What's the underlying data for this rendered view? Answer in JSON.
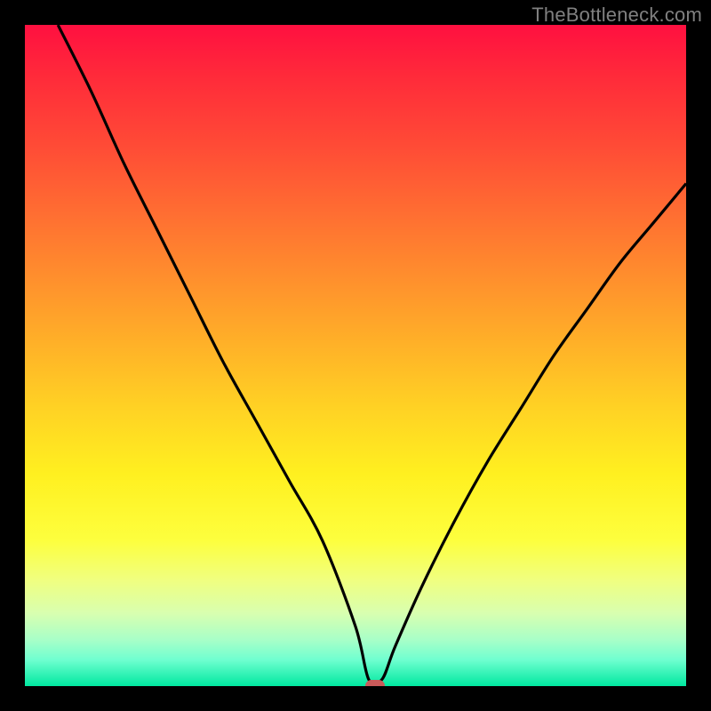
{
  "watermark": "TheBottleneck.com",
  "chart_data": {
    "type": "line",
    "title": "",
    "xlabel": "",
    "ylabel": "",
    "xlim": [
      0,
      100
    ],
    "ylim": [
      0,
      100
    ],
    "grid": false,
    "legend": false,
    "marker": {
      "x": 53,
      "y": 0,
      "color": "#c95a5a"
    },
    "series": [
      {
        "name": "bottleneck-curve",
        "color": "#000000",
        "x": [
          5,
          10,
          15,
          20,
          25,
          30,
          35,
          40,
          45,
          50,
          52,
          54,
          56,
          60,
          65,
          70,
          75,
          80,
          85,
          90,
          95,
          100
        ],
        "y": [
          100,
          90,
          79,
          69,
          59,
          49,
          40,
          31,
          22,
          9,
          1,
          1,
          6,
          15,
          25,
          34,
          42,
          50,
          57,
          64,
          70,
          76
        ]
      }
    ],
    "background_gradient_stops": [
      {
        "pct": 0,
        "color": "#ff1040"
      },
      {
        "pct": 8,
        "color": "#ff2b3a"
      },
      {
        "pct": 18,
        "color": "#ff4a36"
      },
      {
        "pct": 28,
        "color": "#ff6c32"
      },
      {
        "pct": 38,
        "color": "#ff8e2d"
      },
      {
        "pct": 48,
        "color": "#ffb028"
      },
      {
        "pct": 58,
        "color": "#ffd224"
      },
      {
        "pct": 68,
        "color": "#fff020"
      },
      {
        "pct": 78,
        "color": "#fdff3e"
      },
      {
        "pct": 84,
        "color": "#f0ff80"
      },
      {
        "pct": 89,
        "color": "#d8ffb0"
      },
      {
        "pct": 93,
        "color": "#a8ffc8"
      },
      {
        "pct": 96,
        "color": "#70ffd0"
      },
      {
        "pct": 100,
        "color": "#00e8a0"
      }
    ]
  }
}
